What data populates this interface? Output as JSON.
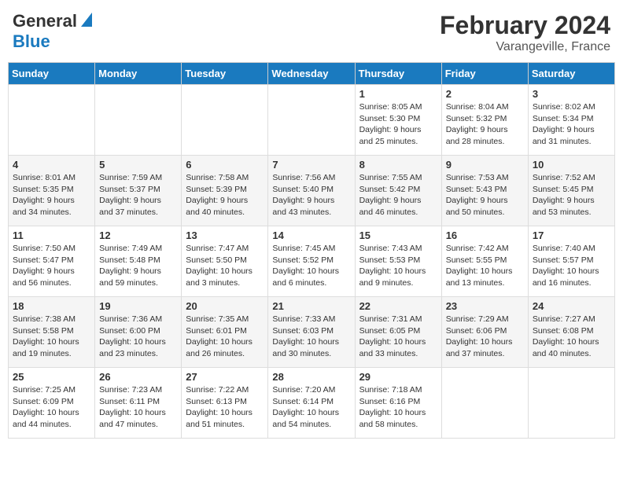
{
  "header": {
    "logo_general": "General",
    "logo_blue": "Blue",
    "month_title": "February 2024",
    "location": "Varangeville, France"
  },
  "days_of_week": [
    "Sunday",
    "Monday",
    "Tuesday",
    "Wednesday",
    "Thursday",
    "Friday",
    "Saturday"
  ],
  "weeks": [
    {
      "days": [
        {
          "number": "",
          "info": ""
        },
        {
          "number": "",
          "info": ""
        },
        {
          "number": "",
          "info": ""
        },
        {
          "number": "",
          "info": ""
        },
        {
          "number": "1",
          "info": "Sunrise: 8:05 AM\nSunset: 5:30 PM\nDaylight: 9 hours\nand 25 minutes."
        },
        {
          "number": "2",
          "info": "Sunrise: 8:04 AM\nSunset: 5:32 PM\nDaylight: 9 hours\nand 28 minutes."
        },
        {
          "number": "3",
          "info": "Sunrise: 8:02 AM\nSunset: 5:34 PM\nDaylight: 9 hours\nand 31 minutes."
        }
      ]
    },
    {
      "days": [
        {
          "number": "4",
          "info": "Sunrise: 8:01 AM\nSunset: 5:35 PM\nDaylight: 9 hours\nand 34 minutes."
        },
        {
          "number": "5",
          "info": "Sunrise: 7:59 AM\nSunset: 5:37 PM\nDaylight: 9 hours\nand 37 minutes."
        },
        {
          "number": "6",
          "info": "Sunrise: 7:58 AM\nSunset: 5:39 PM\nDaylight: 9 hours\nand 40 minutes."
        },
        {
          "number": "7",
          "info": "Sunrise: 7:56 AM\nSunset: 5:40 PM\nDaylight: 9 hours\nand 43 minutes."
        },
        {
          "number": "8",
          "info": "Sunrise: 7:55 AM\nSunset: 5:42 PM\nDaylight: 9 hours\nand 46 minutes."
        },
        {
          "number": "9",
          "info": "Sunrise: 7:53 AM\nSunset: 5:43 PM\nDaylight: 9 hours\nand 50 minutes."
        },
        {
          "number": "10",
          "info": "Sunrise: 7:52 AM\nSunset: 5:45 PM\nDaylight: 9 hours\nand 53 minutes."
        }
      ]
    },
    {
      "days": [
        {
          "number": "11",
          "info": "Sunrise: 7:50 AM\nSunset: 5:47 PM\nDaylight: 9 hours\nand 56 minutes."
        },
        {
          "number": "12",
          "info": "Sunrise: 7:49 AM\nSunset: 5:48 PM\nDaylight: 9 hours\nand 59 minutes."
        },
        {
          "number": "13",
          "info": "Sunrise: 7:47 AM\nSunset: 5:50 PM\nDaylight: 10 hours\nand 3 minutes."
        },
        {
          "number": "14",
          "info": "Sunrise: 7:45 AM\nSunset: 5:52 PM\nDaylight: 10 hours\nand 6 minutes."
        },
        {
          "number": "15",
          "info": "Sunrise: 7:43 AM\nSunset: 5:53 PM\nDaylight: 10 hours\nand 9 minutes."
        },
        {
          "number": "16",
          "info": "Sunrise: 7:42 AM\nSunset: 5:55 PM\nDaylight: 10 hours\nand 13 minutes."
        },
        {
          "number": "17",
          "info": "Sunrise: 7:40 AM\nSunset: 5:57 PM\nDaylight: 10 hours\nand 16 minutes."
        }
      ]
    },
    {
      "days": [
        {
          "number": "18",
          "info": "Sunrise: 7:38 AM\nSunset: 5:58 PM\nDaylight: 10 hours\nand 19 minutes."
        },
        {
          "number": "19",
          "info": "Sunrise: 7:36 AM\nSunset: 6:00 PM\nDaylight: 10 hours\nand 23 minutes."
        },
        {
          "number": "20",
          "info": "Sunrise: 7:35 AM\nSunset: 6:01 PM\nDaylight: 10 hours\nand 26 minutes."
        },
        {
          "number": "21",
          "info": "Sunrise: 7:33 AM\nSunset: 6:03 PM\nDaylight: 10 hours\nand 30 minutes."
        },
        {
          "number": "22",
          "info": "Sunrise: 7:31 AM\nSunset: 6:05 PM\nDaylight: 10 hours\nand 33 minutes."
        },
        {
          "number": "23",
          "info": "Sunrise: 7:29 AM\nSunset: 6:06 PM\nDaylight: 10 hours\nand 37 minutes."
        },
        {
          "number": "24",
          "info": "Sunrise: 7:27 AM\nSunset: 6:08 PM\nDaylight: 10 hours\nand 40 minutes."
        }
      ]
    },
    {
      "days": [
        {
          "number": "25",
          "info": "Sunrise: 7:25 AM\nSunset: 6:09 PM\nDaylight: 10 hours\nand 44 minutes."
        },
        {
          "number": "26",
          "info": "Sunrise: 7:23 AM\nSunset: 6:11 PM\nDaylight: 10 hours\nand 47 minutes."
        },
        {
          "number": "27",
          "info": "Sunrise: 7:22 AM\nSunset: 6:13 PM\nDaylight: 10 hours\nand 51 minutes."
        },
        {
          "number": "28",
          "info": "Sunrise: 7:20 AM\nSunset: 6:14 PM\nDaylight: 10 hours\nand 54 minutes."
        },
        {
          "number": "29",
          "info": "Sunrise: 7:18 AM\nSunset: 6:16 PM\nDaylight: 10 hours\nand 58 minutes."
        },
        {
          "number": "",
          "info": ""
        },
        {
          "number": "",
          "info": ""
        }
      ]
    }
  ]
}
